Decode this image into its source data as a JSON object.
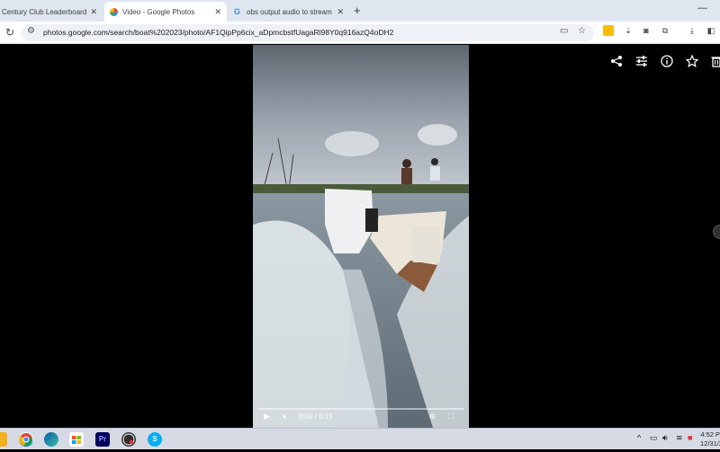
{
  "browser": {
    "tabs": [
      {
        "title": "Century Club Leaderboard | Pa...",
        "active": false
      },
      {
        "title": "Video - Google Photos",
        "active": true
      },
      {
        "title": "obs output audio to stream set",
        "active": false
      }
    ],
    "new_tab": "+",
    "minimize": "—",
    "url": "photos.google.com/search/boat%202023/photo/AF1QipPp6cix_aDpmcbstfUagaRl98Y0q916azQ4oDH2"
  },
  "video": {
    "current_time": "0:00 / 0:15",
    "progress": 0
  },
  "photo_toolbar": [
    "share-icon",
    "adjust-icon",
    "info-icon",
    "favorite-icon",
    "delete-icon"
  ],
  "taskbar": {
    "apps": [
      {
        "name": "chrome",
        "label": ""
      },
      {
        "name": "edge",
        "label": ""
      },
      {
        "name": "store",
        "label": ""
      },
      {
        "name": "premiere",
        "label": "Pr"
      },
      {
        "name": "obs",
        "label": ""
      },
      {
        "name": "skype",
        "label": "S"
      }
    ],
    "time": "4:52 P",
    "date": "12/31/2"
  },
  "colors": {
    "tabbar": "#dfe6f0",
    "taskbar": "#d6dae4",
    "accent": "#1a73e8"
  }
}
